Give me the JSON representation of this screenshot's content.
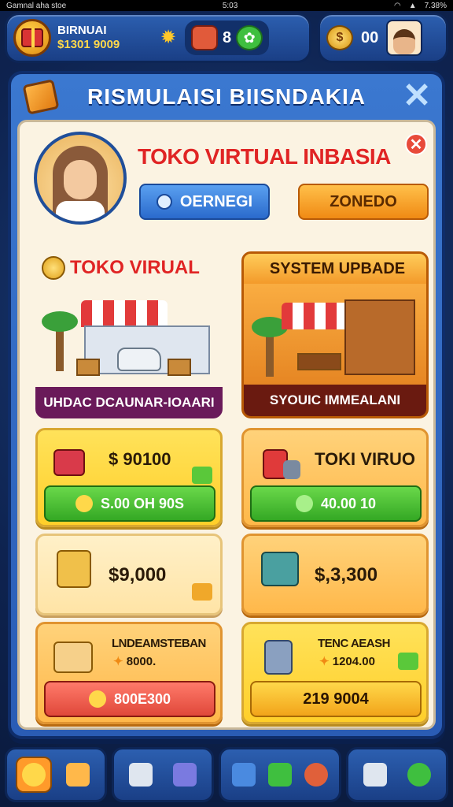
{
  "status_bar": {
    "left": "Gamnal aha stoe",
    "time": "5:03",
    "right": "7.38%"
  },
  "top_bar": {
    "player_name": "BIRNUAI",
    "player_money": "$1301 9009",
    "resource_1": "8",
    "resource_2": "00"
  },
  "panel": {
    "title": "RISMULAISI BIISNDAKIA",
    "shop_name": "TOKO VIRTUAL INBASIA",
    "button_blue": "OERNEGI",
    "button_orange": "ZONEDO"
  },
  "cards": {
    "shop1": {
      "title": "TOKO VIRUAL",
      "caption": "UHDAC DCAUNAR-IOAARI"
    },
    "shop2": {
      "title": "SYSTEM UPBADE",
      "caption": "SYOUIC IMMEALANI"
    }
  },
  "tiles": [
    {
      "value": "$ 90100",
      "button": "S.00 OH 90S"
    },
    {
      "value": "TOKI VIRUO",
      "button": "40.00 10"
    },
    {
      "value": "$9,000"
    },
    {
      "value": "$,3,300"
    },
    {
      "label": "LNDEAMSTEBAN",
      "sub": "8000.",
      "button": "800E300"
    },
    {
      "label": "TENC AEASH",
      "sub": "1204.00",
      "button": "219 9004"
    }
  ],
  "icons": [
    "gift-icon",
    "gear-icon",
    "package-icon",
    "leaf-icon",
    "coin-stack-icon",
    "close-icon"
  ],
  "colors": {
    "panel_blue": "#2a5cb5",
    "title_red": "#e02424",
    "accent_orange": "#f08a14",
    "accent_green": "#34a824"
  }
}
